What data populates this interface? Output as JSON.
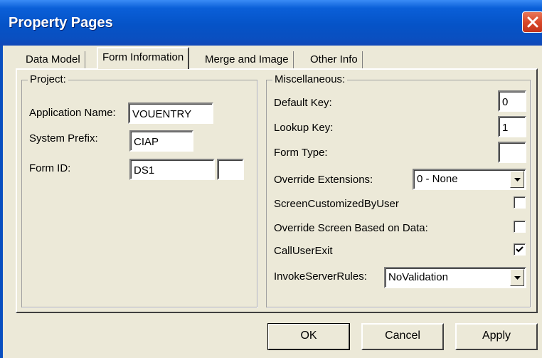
{
  "window": {
    "title": "Property Pages"
  },
  "tabs": [
    {
      "label": "Data Model",
      "active": false
    },
    {
      "label": "Form Information",
      "active": true
    },
    {
      "label": "Merge and Image",
      "active": false
    },
    {
      "label": "Other Info",
      "active": false
    }
  ],
  "project": {
    "legend": "Project:",
    "application_name_label": "Application Name:",
    "application_name_value": "VOUENTRY",
    "system_prefix_label": "System Prefix:",
    "system_prefix_value": "CIAP",
    "form_id_label": "Form ID:",
    "form_id_value": "DS1",
    "form_id_suffix_value": ""
  },
  "misc": {
    "legend": "Miscellaneous:",
    "default_key_label": "Default Key:",
    "default_key_value": "0",
    "lookup_key_label": "Lookup Key:",
    "lookup_key_value": "1",
    "form_type_label": "Form Type:",
    "form_type_value": "",
    "override_extensions_label": "Override Extensions:",
    "override_extensions_value": "0 - None",
    "screen_customized_label": "ScreenCustomizedByUser",
    "screen_customized_checked": false,
    "override_screen_label": "Override Screen Based on Data:",
    "override_screen_checked": false,
    "call_user_exit_label": "CallUserExit",
    "call_user_exit_checked": true,
    "invoke_server_rules_label": "InvokeServerRules:",
    "invoke_server_rules_value": "NoValidation"
  },
  "buttons": {
    "ok": "OK",
    "cancel": "Cancel",
    "apply": "Apply"
  },
  "icons": {
    "close": "close-icon",
    "dropdown": "chevron-down-icon",
    "check": "checkmark-icon"
  },
  "colors": {
    "titlebar": "#0553c7",
    "close": "#d9482a",
    "face": "#ece9d8"
  }
}
